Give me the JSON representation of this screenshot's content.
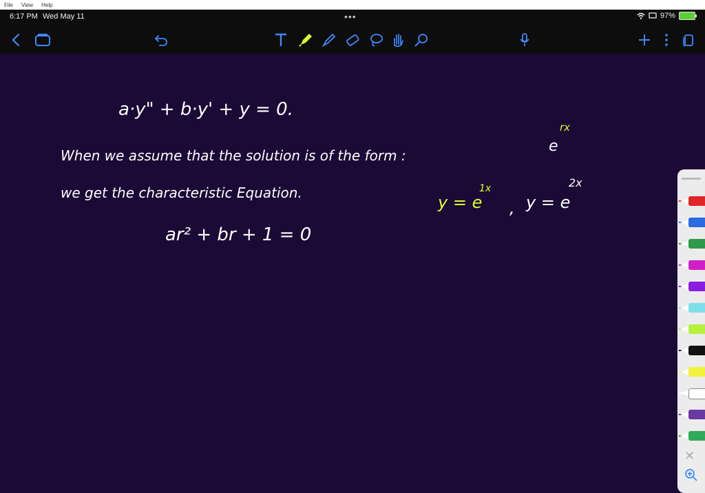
{
  "menubar": {
    "items": [
      "File",
      "View",
      "Help"
    ]
  },
  "status": {
    "time": "6:17 PM",
    "date": "Wed May 11",
    "battery": "97%"
  },
  "toolbar": {
    "icons": [
      "back-icon",
      "documents-icon",
      "undo-icon",
      "text-tool-icon",
      "pen-tool-icon",
      "highlighter-tool-icon",
      "eraser-tool-icon",
      "lasso-tool-icon",
      "hand-tool-icon",
      "laser-pointer-icon",
      "microphone-icon",
      "add-page-icon",
      "more-options-icon",
      "pages-icon"
    ]
  },
  "notes": {
    "line1": "a·y\" + b·y' + y = 0.",
    "line2": "When we assume that the solution is of the form :",
    "form_base": "e",
    "form_exp": "rx",
    "line3": "we get the characteristic Equation.",
    "line4": "ar² + br + 1 = 0",
    "sol1_base": "y = e",
    "sol1_exp": "1x",
    "comma": ",",
    "sol2_base": "y = e",
    "sol2_exp": "2x"
  },
  "colors": {
    "canvas": "#1b0a35",
    "ink_white": "#ffffff",
    "ink_green": "#d9ff2f",
    "toolbar": "#0d0d0d",
    "accent": "#3d8bff"
  },
  "pen_tray": {
    "pens": [
      "red",
      "blue",
      "green",
      "magenta",
      "purple",
      "cyan",
      "lime",
      "black",
      "yellow",
      "white",
      "violet",
      "emerald"
    ],
    "pen_colors": [
      "#e0262a",
      "#2a6be0",
      "#2e9b4a",
      "#d11ec8",
      "#8a1ee0",
      "#7de0e8",
      "#b6f23c",
      "#111111",
      "#f2f23c",
      "#ffffff",
      "#6a3aa0",
      "#2eaa5a"
    ]
  }
}
